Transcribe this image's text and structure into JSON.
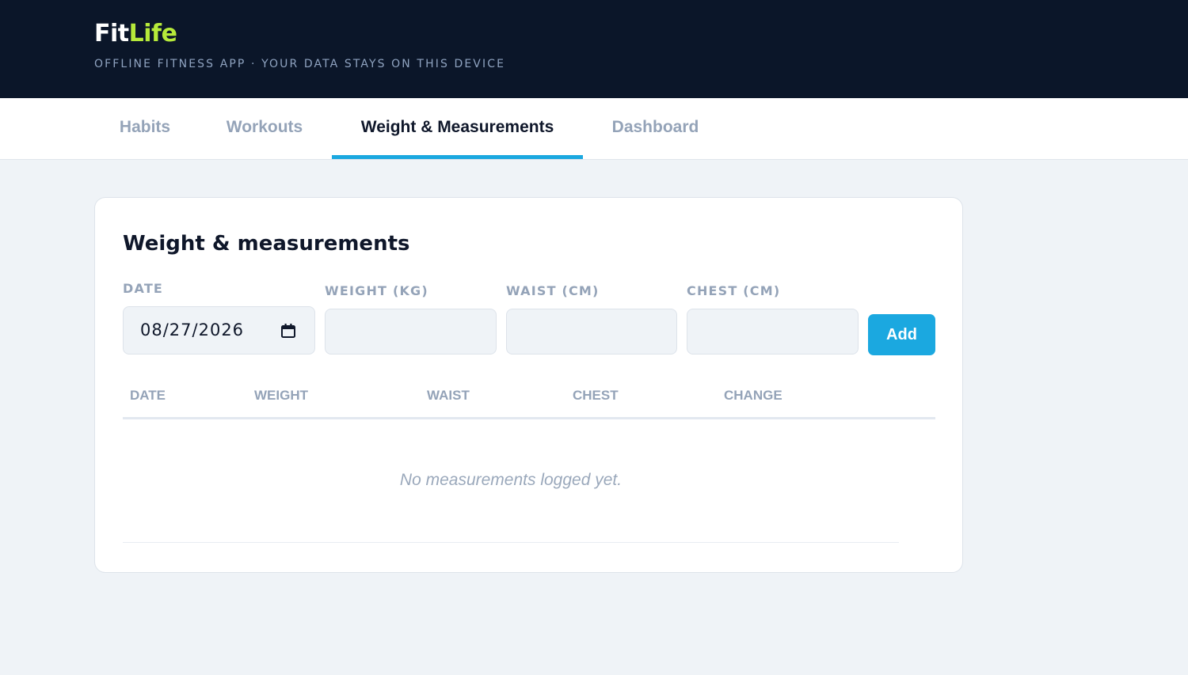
{
  "header": {
    "brand_part1": "Fit",
    "brand_part2": "Life",
    "tagline": "OFFLINE FITNESS APP · YOUR DATA STAYS ON THIS DEVICE",
    "background_color": "#0b1629",
    "accent_color": "#b6ea3a"
  },
  "tabs": [
    {
      "label": "Habits",
      "active": false
    },
    {
      "label": "Workouts",
      "active": false
    },
    {
      "label": "Weight & Measurements",
      "active": true
    },
    {
      "label": "Dashboard",
      "active": false
    }
  ],
  "card": {
    "title": "Weight & measurements",
    "fields": {
      "date": {
        "label": "DATE",
        "value": "08/27/2026",
        "icon": "calendar-icon"
      },
      "weight": {
        "label": "WEIGHT (KG)",
        "value": ""
      },
      "waist": {
        "label": "WAIST (CM)",
        "value": ""
      },
      "chest": {
        "label": "CHEST (CM)",
        "value": ""
      }
    },
    "add_label": "Add",
    "table": {
      "columns": [
        "DATE",
        "WEIGHT",
        "WAIST",
        "CHEST",
        "CHANGE"
      ],
      "rows": [],
      "empty_message": "No measurements logged yet."
    }
  },
  "colors": {
    "primary": "#1ba8e0",
    "page_background": "#eff3f7",
    "muted_text": "#94a3b8"
  }
}
